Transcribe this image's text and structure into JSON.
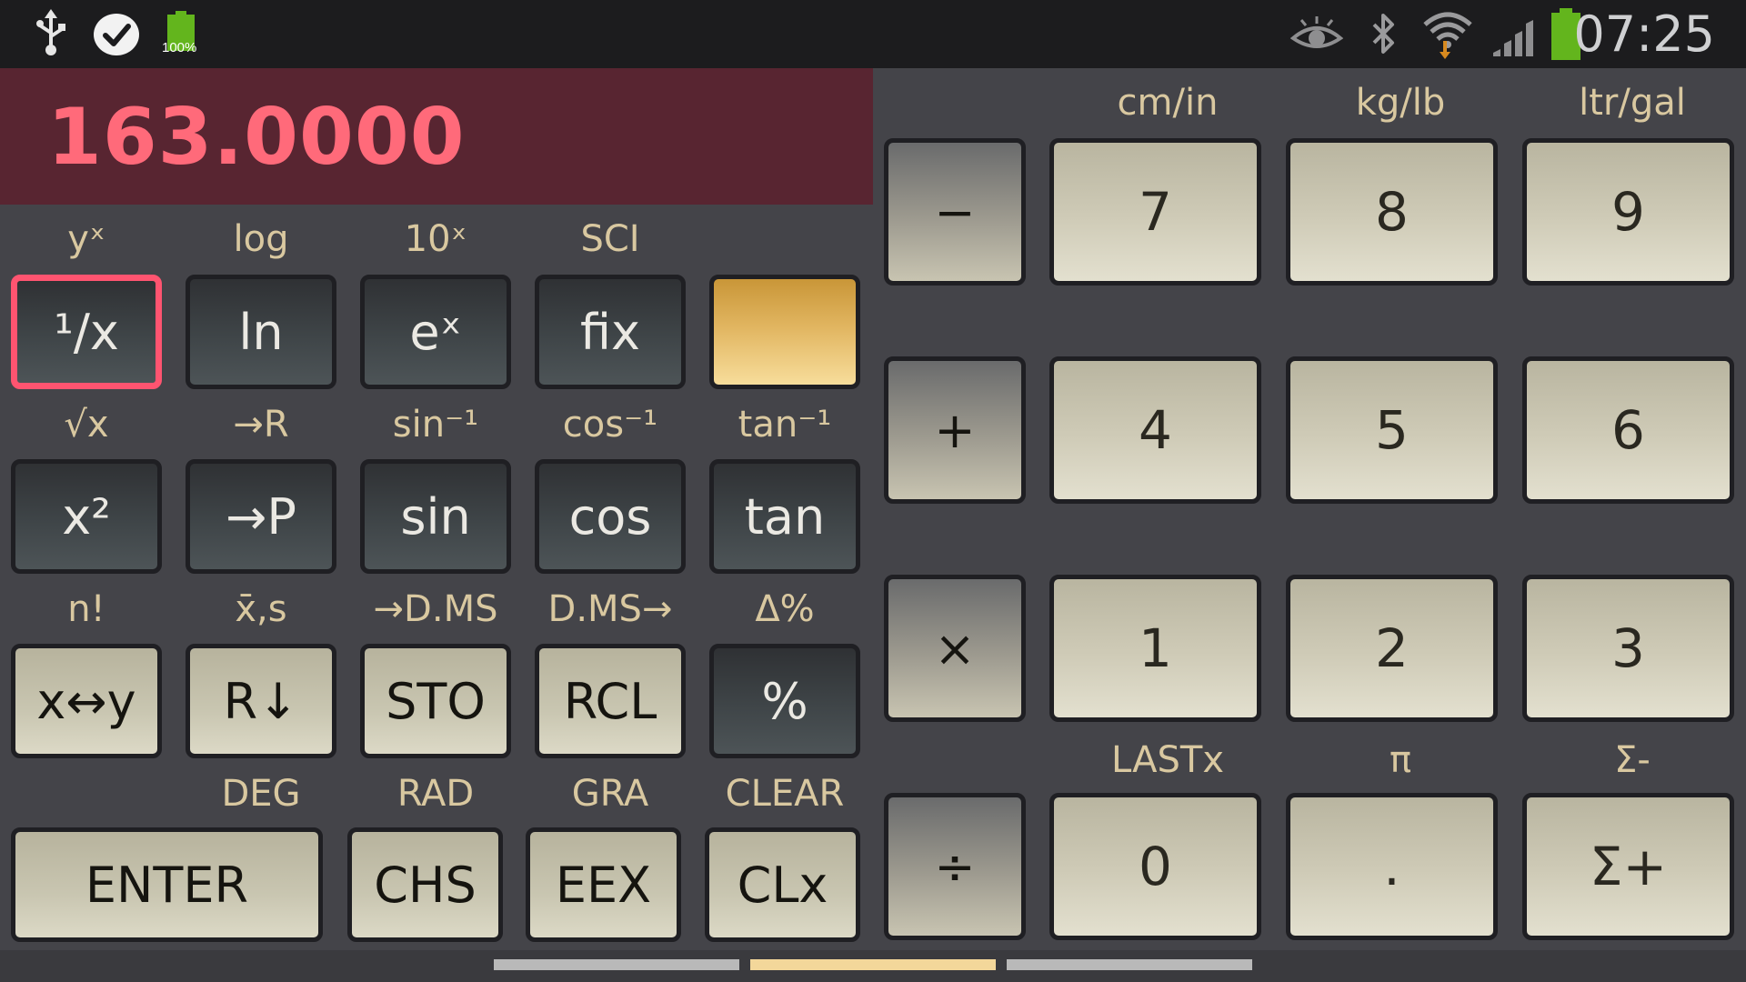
{
  "status_bar": {
    "battery_small_label": "100%",
    "time": "07:25",
    "icons_left": [
      "usb-icon",
      "check-bubble-icon",
      "battery-full-icon"
    ],
    "icons_right": [
      "eye-icon",
      "bluetooth-icon",
      "wifi-icon",
      "signal-icon",
      "battery-icon"
    ]
  },
  "display": {
    "value": "163.0000"
  },
  "shift_labels": {
    "row1": [
      "yˣ",
      "log",
      "10ˣ",
      "SCI",
      ""
    ],
    "row2": [
      "√x",
      "→R",
      "sin⁻¹",
      "cos⁻¹",
      "tan⁻¹"
    ],
    "row3": [
      "n!",
      "x̄,s",
      "→D.MS",
      "D.MS→",
      "Δ%"
    ],
    "row4": [
      "",
      "DEG",
      "RAD",
      "GRA",
      "CLEAR"
    ]
  },
  "keys": {
    "row1": [
      "¹/x",
      "ln",
      "eˣ",
      "fix",
      ""
    ],
    "row2": [
      "x²",
      "→P",
      "sin",
      "cos",
      "tan"
    ],
    "row3": [
      "x↔y",
      "R↓",
      "STO",
      "RCL",
      "%"
    ],
    "row4": [
      "ENTER",
      "CHS",
      "EEX",
      "CLx"
    ]
  },
  "numpad": {
    "top_labels": [
      "cm/in",
      "kg/lb",
      "ltr/gal"
    ],
    "bottom_labels": [
      "LASTx",
      "π",
      "Σ-"
    ],
    "operators": [
      "−",
      "+",
      "×",
      "÷"
    ],
    "row1": [
      "7",
      "8",
      "9"
    ],
    "row2": [
      "4",
      "5",
      "6"
    ],
    "row3": [
      "1",
      "2",
      "3"
    ],
    "row4": [
      "0",
      ".",
      "Σ+"
    ]
  },
  "colors": {
    "display_bg": "#582531",
    "display_text": "#ff6a7a",
    "shift_label": "#d9c8a0",
    "selected_border": "#ff5470",
    "gold_key": "#e1b560",
    "page_active": "#f3d79a",
    "page_inactive": "#b9b9b9"
  },
  "page_indicator": {
    "count": 3,
    "active": 2
  }
}
